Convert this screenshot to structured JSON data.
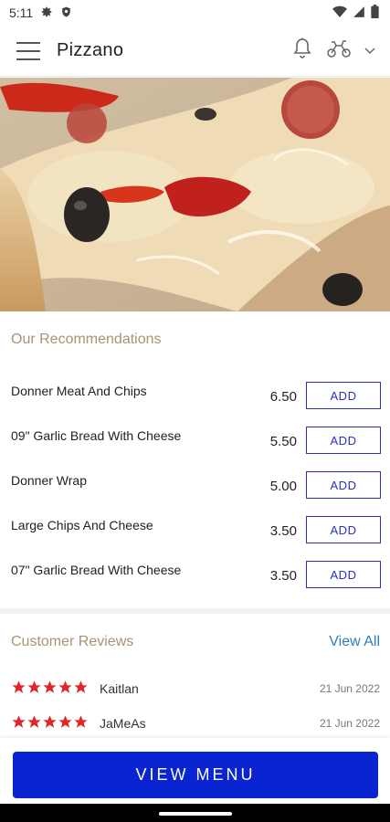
{
  "status_bar": {
    "time": "5:11",
    "icons": [
      "gear-icon",
      "shield-icon",
      "wifi-icon",
      "signal-icon",
      "battery-icon"
    ]
  },
  "app_bar": {
    "title": "Pizzano",
    "icons": [
      "menu-icon",
      "bell-icon",
      "scooter-icon",
      "chevron-down-icon"
    ]
  },
  "hero": {
    "image": "pizza-photo"
  },
  "recommendations": {
    "title": "Our Recommendations",
    "items": [
      {
        "name": "Donner Meat And Chips",
        "price": "6.50",
        "add_label": "ADD"
      },
      {
        "name": "09\" Garlic Bread With Cheese",
        "price": "5.50",
        "add_label": "ADD"
      },
      {
        "name": "Donner Wrap",
        "price": "5.00",
        "add_label": "ADD"
      },
      {
        "name": "Large Chips And Cheese",
        "price": "3.50",
        "add_label": "ADD"
      },
      {
        "name": "07\" Garlic Bread With Cheese",
        "price": "3.50",
        "add_label": "ADD"
      }
    ]
  },
  "reviews": {
    "title": "Customer Reviews",
    "view_all": "View All",
    "items": [
      {
        "stars": 5,
        "name": "Kaitlan",
        "date": "21 Jun 2022"
      },
      {
        "stars": 5,
        "name": "JaMeAs",
        "date": "21 Jun 2022"
      }
    ]
  },
  "footer": {
    "view_menu": "VIEW MENU"
  },
  "colors": {
    "accent": "#0b24d1",
    "add_border": "#2a32b8",
    "section_title": "#a89372",
    "link": "#2b7fc0",
    "star": "#e0262b"
  }
}
